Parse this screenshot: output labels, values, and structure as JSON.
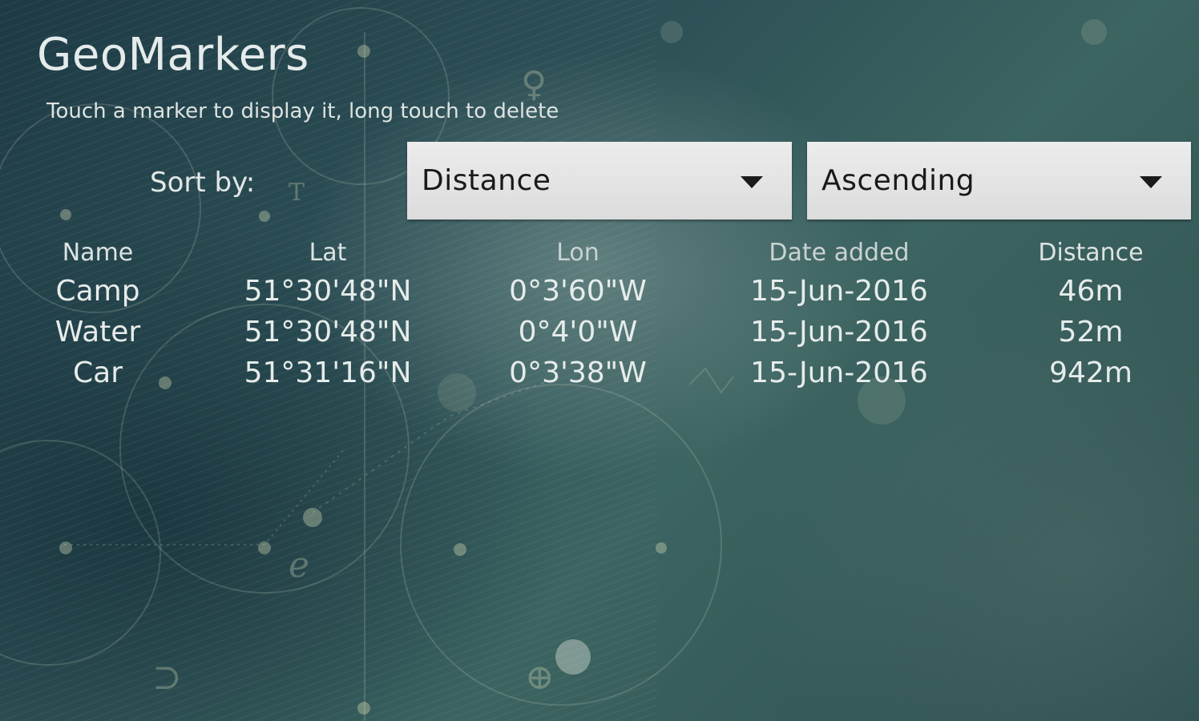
{
  "app": {
    "title": "GeoMarkers"
  },
  "hint": "Touch a marker to display it, long touch to delete",
  "sort": {
    "label": "Sort by:",
    "field": "Distance",
    "order": "Ascending"
  },
  "table": {
    "headers": [
      "Name",
      "Lat",
      "Lon",
      "Date added",
      "Distance"
    ],
    "rows": [
      [
        "Camp",
        "51°30'48\"N",
        "0°3'60\"W",
        "15-Jun-2016",
        "46m"
      ],
      [
        "Water",
        "51°30'48\"N",
        "0°4'0\"W",
        "15-Jun-2016",
        "52m"
      ],
      [
        "Car",
        "51°31'16\"N",
        "0°3'38\"W",
        "15-Jun-2016",
        "942m"
      ]
    ]
  },
  "colors": {
    "background": "#2d5056",
    "dropdown": "#e4e4e4",
    "text": "#dfe6e4"
  }
}
